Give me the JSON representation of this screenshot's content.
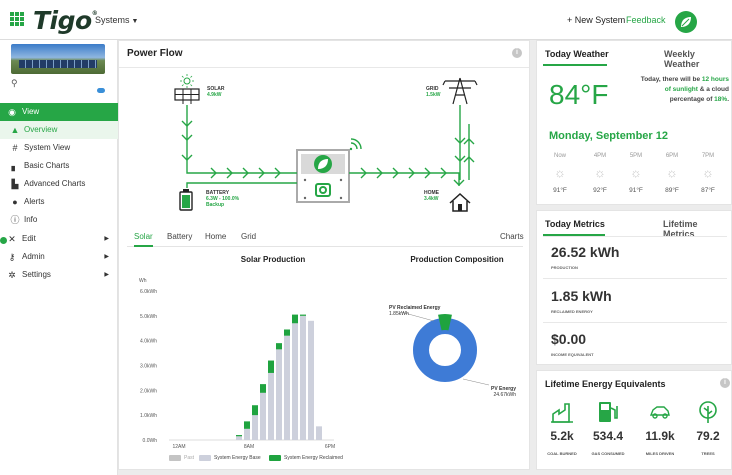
{
  "app": {
    "name": "Tigo",
    "systems_menu": "Systems"
  },
  "header": {
    "new_system": "+ New System",
    "feedback": "Feedback"
  },
  "sidebar": {
    "items": [
      {
        "label": "View"
      },
      {
        "label": "Overview"
      },
      {
        "label": "System View"
      },
      {
        "label": "Basic Charts"
      },
      {
        "label": "Advanced Charts"
      },
      {
        "label": "Alerts"
      },
      {
        "label": "Info"
      },
      {
        "label": "Edit"
      },
      {
        "label": "Admin"
      },
      {
        "label": "Settings"
      }
    ]
  },
  "power_flow": {
    "title": "Power Flow",
    "solar": {
      "label": "SOLAR",
      "value": "4.9kW"
    },
    "grid": {
      "label": "GRID",
      "value": "1.5kW"
    },
    "battery": {
      "label": "BATTERY",
      "value": "6.3W - 100.0%",
      "mode": "Backup"
    },
    "home": {
      "label": "HOME",
      "value": "3.4kW"
    }
  },
  "tabs": {
    "solar": "Solar",
    "battery": "Battery",
    "home": "Home",
    "grid": "Grid",
    "charts": "Charts"
  },
  "solar_production": {
    "title": "Solar Production",
    "unit": "Wh",
    "colors": {
      "base": "#cdd0dc",
      "reclaimed": "#1fa33f",
      "past": "#c4c4c4"
    }
  },
  "chart_data": [
    {
      "type": "bar",
      "title": "Solar Production",
      "ylabel": "Wh",
      "ylim": [
        0,
        6000
      ],
      "yticks": [
        "0.0Wh",
        "1.0kWh",
        "2.0kWh",
        "3.0kWh",
        "4.0kWh",
        "5.0kWh",
        "6.0kWh"
      ],
      "xticks": [
        "12AM",
        "8AM",
        "6PM"
      ],
      "categories": [
        "6AM",
        "7AM",
        "8AM",
        "9AM",
        "10AM",
        "11AM",
        "12PM",
        "1PM",
        "2PM",
        "3PM",
        "4PM"
      ],
      "series": [
        {
          "name": "System Energy Base",
          "values": [
            150,
            450,
            1000,
            1900,
            2700,
            3650,
            4200,
            4700,
            5000,
            4800,
            550
          ]
        },
        {
          "name": "System Energy Reclaimed",
          "values": [
            50,
            300,
            400,
            350,
            500,
            250,
            250,
            350,
            50,
            0,
            0
          ]
        }
      ],
      "legend": [
        "Past",
        "System Energy Base",
        "System Energy Reclaimed"
      ]
    },
    {
      "type": "pie",
      "title": "Production Composition",
      "slices": [
        {
          "name": "PV Reclaimed Energy",
          "value": 1.85,
          "label": "1.85kWh",
          "color": "#1fa33f"
        },
        {
          "name": "PV Energy",
          "value": 24.67,
          "label": "24.67kWh",
          "color": "#3e7bd6"
        }
      ]
    }
  ],
  "legend": {
    "past": "Past",
    "base": "System Energy Base",
    "reclaimed": "System Energy Reclaimed"
  },
  "weather": {
    "tab_today": "Today Weather",
    "tab_weekly": "Weekly Weather",
    "temperature": "84°F",
    "summary_prefix": "Today, there will be ",
    "sunlight_hours": "12",
    "summary_mid": " hours of sunlight",
    "summary_mid2": " & a cloud percentage of ",
    "cloud_pct": "18%",
    "summary_end": ".",
    "date": "Monday, September 12",
    "forecast": [
      {
        "time": "Now",
        "temp": "91°F"
      },
      {
        "time": "4PM",
        "temp": "92°F"
      },
      {
        "time": "5PM",
        "temp": "91°F"
      },
      {
        "time": "6PM",
        "temp": "89°F"
      },
      {
        "time": "7PM",
        "temp": "87°F"
      }
    ]
  },
  "metrics": {
    "tab_today": "Today Metrics",
    "tab_lifetime": "Lifetime Metrics",
    "production_value": "26.52 kWh",
    "production_label": "PRODUCTION",
    "reclaimed_value": "1.85 kWh",
    "reclaimed_label": "RECLAIMED ENERGY",
    "income_value": "$0.00",
    "income_label": "INCOME EQUIVALENT"
  },
  "equivalents": {
    "title": "Lifetime Energy Equivalents",
    "items": [
      {
        "value": "5.2k",
        "label": "COAL BURNED",
        "icon": "factory-icon"
      },
      {
        "value": "534.4",
        "label": "GAS CONSUMED",
        "icon": "gas-pump-icon"
      },
      {
        "value": "11.9k",
        "label": "MILES DRIVEN",
        "icon": "car-icon"
      },
      {
        "value": "79.2",
        "label": "TREES",
        "icon": "tree-icon"
      }
    ]
  }
}
